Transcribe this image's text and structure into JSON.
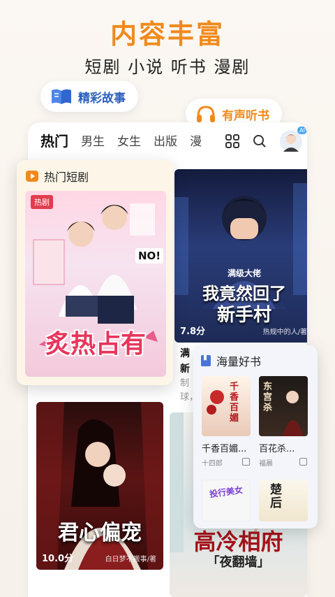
{
  "headline": "内容丰富",
  "subline": "短剧 小说 听书 漫剧",
  "pills": {
    "story": "精彩故事",
    "audio": "有声听书"
  },
  "tabs": [
    "热门",
    "男生",
    "女生",
    "出版",
    "漫"
  ],
  "tab_icons": [
    "grid-icon",
    "search-icon",
    "avatar-icon"
  ],
  "avatar_badge": "AI",
  "cards": {
    "top": {
      "banner": "满级大佬",
      "title_line1": "我竟然回了",
      "title_line2": "新手村",
      "score": "7.8分",
      "author": "热规中的人/著"
    },
    "peek_lines": [
      "满",
      "新",
      "制",
      "球，"
    ],
    "bottom": {
      "title": "君心偏宠",
      "score": "10.0分",
      "author": "白日梦不搬事/著"
    },
    "peek_bottom": {
      "title": "高冷相府",
      "subtitle": "「夜翻墙」"
    }
  },
  "short_drama_panel": {
    "header": "热门短剧",
    "tag": "热剧",
    "title": "炙热占有",
    "no_text": "NO!"
  },
  "books_panel": {
    "header": "海量好书",
    "books": [
      {
        "title": "千香百媚...",
        "author": "十四郎",
        "cover_text": "千香百媚"
      },
      {
        "title": "百花杀...",
        "author": "福晨",
        "cover_text": "东宫杀"
      },
      {
        "title": "",
        "author": "",
        "cover_text": "投行美女"
      },
      {
        "title": "",
        "author": "",
        "cover_text": "楚后"
      }
    ]
  },
  "colors": {
    "accent": "#f08a1c",
    "story_blue": "#2c5fbf",
    "short_panel": "#fdf6e8"
  }
}
